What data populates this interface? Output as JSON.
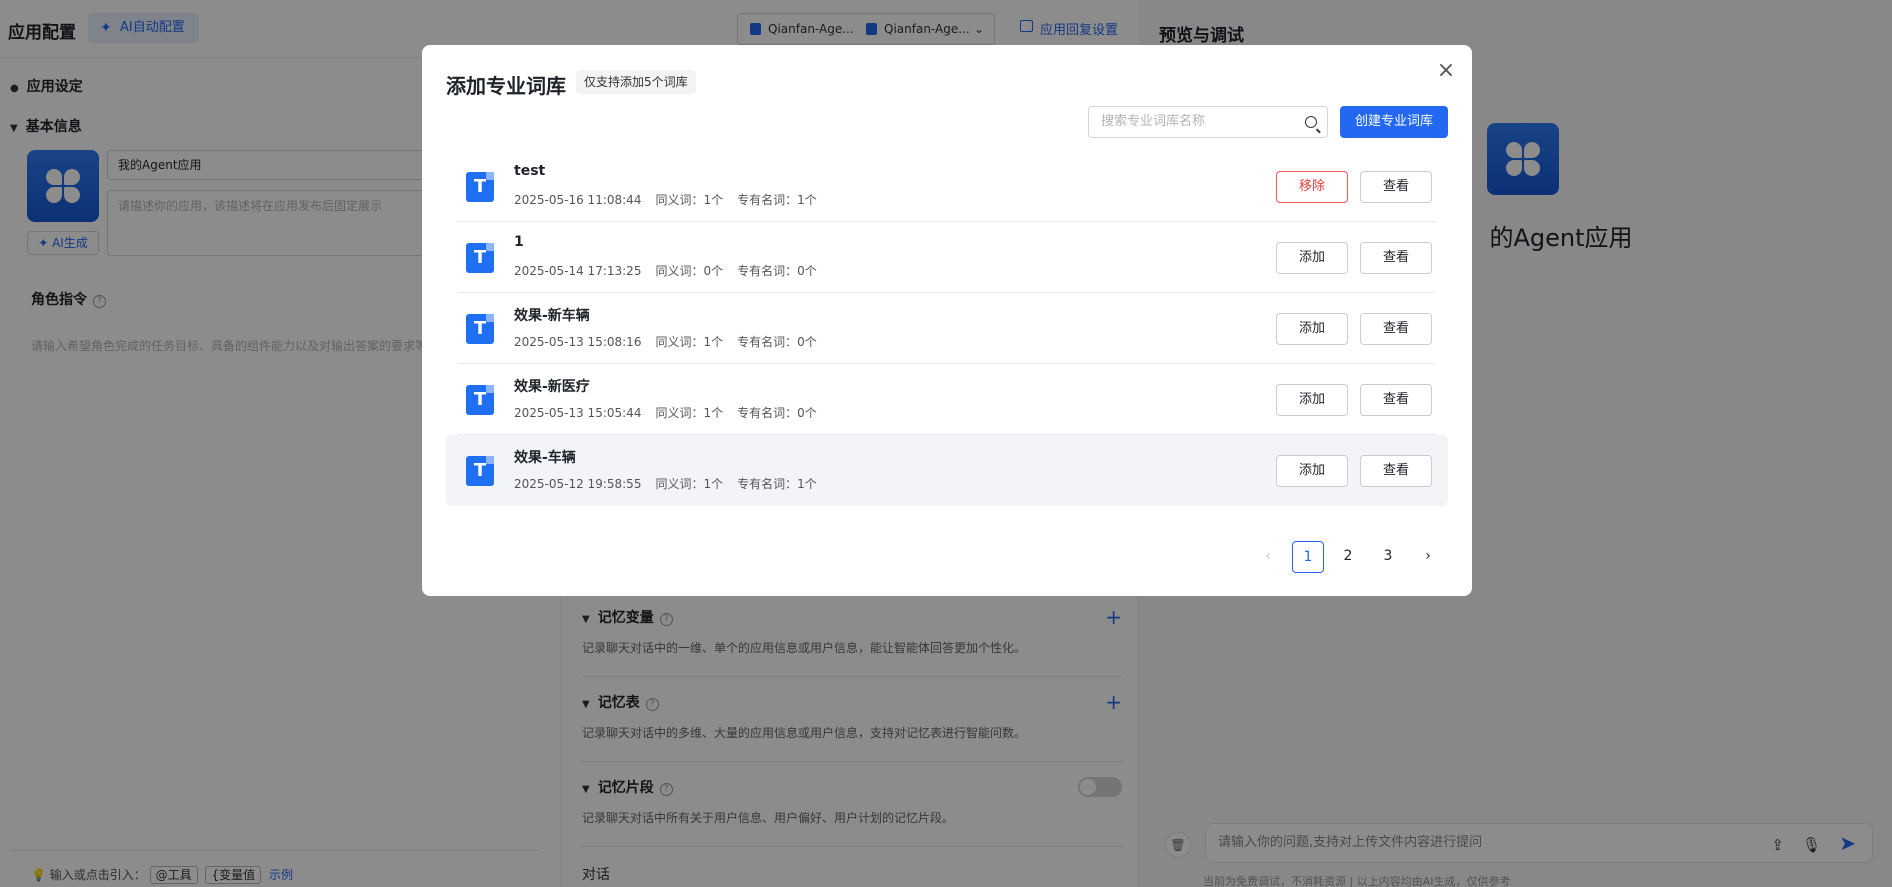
{
  "header": {
    "title": "应用配置",
    "ai_config_label": "AI自动配置",
    "model_a": "Qianfan-Age...",
    "model_b": "Qianfan-Age...",
    "reply_settings": "应用回复设置"
  },
  "left": {
    "app_settings": "应用设定",
    "basic_info": "基本信息",
    "app_name": "我的Agent应用",
    "desc_placeholder": "请描述你的应用，该描述将在应用发布后固定展示",
    "ai_gen": "AI生成",
    "role_title": "角色指令",
    "role_placeholder": "请输入希望角色完成的任务目标、具备的组件能力以及对输出答案的要求等",
    "tip_prefix": "输入或点击引入：",
    "tag_tool": "@工具",
    "tag_var": "{变量值",
    "example": "示例"
  },
  "memory": {
    "var_title": "记忆变量",
    "var_desc": "记录聊天对话中的一维、单个的应用信息或用户信息，能让智能体回答更加个性化。",
    "table_title": "记忆表",
    "table_desc": "记录聊天对话中的多维、大量的应用信息或用户信息，支持对记忆表进行智能问数。",
    "snippet_title": "记忆片段",
    "snippet_desc": "记录聊天对话中所有关于用户信息、用户偏好、用户计划的记忆片段。",
    "dialog_label": "对话"
  },
  "preview": {
    "title": "预览与调试",
    "app_name": "的Agent应用",
    "chat_placeholder": "请输入你的问题,支持对上传文件内容进行提问",
    "disclaimer": "当前为免费调试，不消耗资源  |  以上内容均由AI生成，仅供参考"
  },
  "modal": {
    "title": "添加专业词库",
    "badge": "仅支持添加5个词库",
    "search_placeholder": "搜索专业词库名称",
    "create_label": "创建专业词库",
    "view_label": "查看",
    "libraries": [
      {
        "name": "test",
        "date": "2025-05-16 11:08:44",
        "synonyms": "同义词：1个",
        "terms": "专有名词：1个",
        "action": "移除"
      },
      {
        "name": "1",
        "date": "2025-05-14 17:13:25",
        "synonyms": "同义词：0个",
        "terms": "专有名词：0个",
        "action": "添加"
      },
      {
        "name": "效果-新车辆",
        "date": "2025-05-13 15:08:16",
        "synonyms": "同义词：1个",
        "terms": "专有名词：0个",
        "action": "添加"
      },
      {
        "name": "效果-新医疗",
        "date": "2025-05-13 15:05:44",
        "synonyms": "同义词：1个",
        "terms": "专有名词：0个",
        "action": "添加"
      },
      {
        "name": "效果-车辆",
        "date": "2025-05-12 19:58:55",
        "synonyms": "同义词：1个",
        "terms": "专有名词：1个",
        "action": "添加"
      }
    ],
    "pagination": {
      "prev": "‹",
      "pages": [
        "1",
        "2",
        "3"
      ],
      "current": "1",
      "next": "›"
    }
  },
  "colors": {
    "primary": "#2468f2",
    "danger": "#e63a3a",
    "overlay": "rgba(0,0,0,0.45)"
  }
}
